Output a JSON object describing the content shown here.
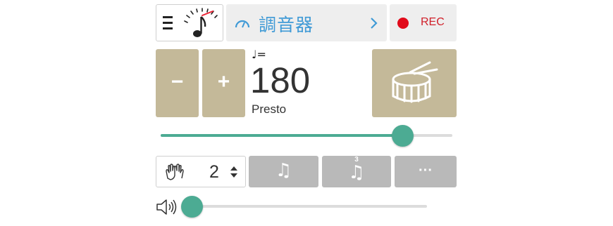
{
  "top_bar": {
    "menu_icon": "hamburger-menu-icon",
    "metronome_icon": "metronome-note-icon",
    "tuner": {
      "icon": "gauge-icon",
      "label": "調音器",
      "chevron_icon": "chevron-right-icon"
    },
    "rec": {
      "label": "REC",
      "dot_color": "#e10a1a"
    }
  },
  "tempo": {
    "note_equals": "♩=",
    "bpm": "180",
    "marking": "Presto",
    "minus_label": "−",
    "plus_label": "+",
    "drum_icon": "snare-drum-icon",
    "slider_fraction": 0.83
  },
  "beats": {
    "icon": "clapping-hands-icon",
    "value": "2",
    "stepper_icon": "up-down-stepper-icon"
  },
  "subdivisions": [
    {
      "name": "eighth-notes",
      "glyph": "♫"
    },
    {
      "name": "triplets",
      "glyph": "♫",
      "tuplet": "3"
    },
    {
      "name": "more",
      "glyph": "···"
    }
  ],
  "volume": {
    "icon": "speaker-icon",
    "fraction": 0.03
  },
  "colors": {
    "accent": "#4cab93",
    "tan": "#c4b999",
    "tuner_blue": "#3f9ad6",
    "rec_red": "#e10a1a"
  }
}
